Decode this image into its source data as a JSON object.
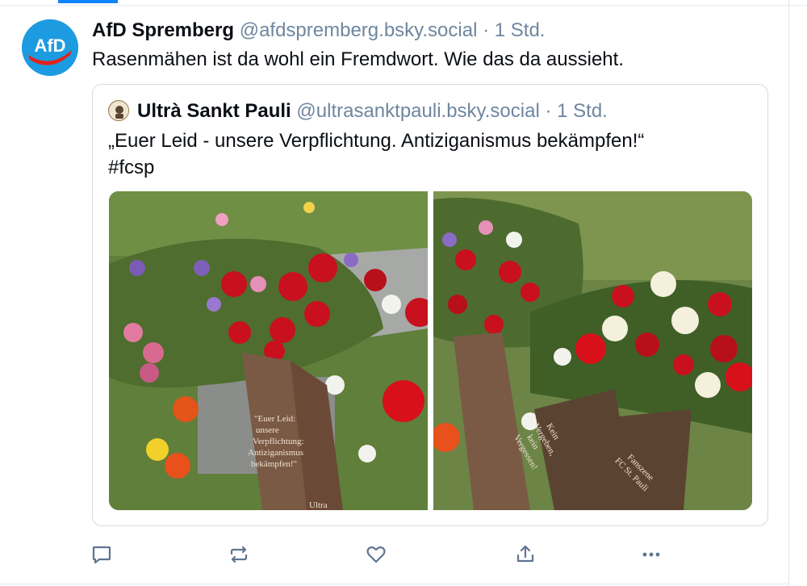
{
  "post": {
    "author_name": "AfD Spremberg",
    "author_handle": "@afdspremberg.bsky.social",
    "separator": "·",
    "time": "1 Std.",
    "avatar_text": "AfD",
    "text": "Rasenmähen ist da wohl ein Fremdwort. Wie das da aussieht."
  },
  "quote": {
    "author_name": "Ultrà Sankt Pauli",
    "author_handle": "@ultrasanktpauli.bsky.social",
    "separator": "·",
    "time": "1 Std.",
    "text_lines": [
      "„Euer Leid - unsere Verpflichtung. Antiziganismus bekämpfen!“",
      "#fcsp"
    ],
    "images": [
      {
        "ribbon_lines": [
          "\"Euer Leid:",
          "unsere",
          "Verpflichtung:",
          "Antiziganismus",
          "bekämpfen!\""
        ],
        "ribbon_footer": "Ultra"
      },
      {
        "ribbon_left_lines": [
          "Kein",
          "Vergeben,",
          "kein",
          "Vergessen!"
        ],
        "ribbon_right_lines": [
          "Fanszene",
          "FC St. Pauli"
        ]
      }
    ]
  },
  "actions": [
    {
      "name": "reply",
      "icon": "speech-bubble-icon"
    },
    {
      "name": "repost",
      "icon": "repost-icon"
    },
    {
      "name": "like",
      "icon": "heart-icon"
    },
    {
      "name": "share",
      "icon": "share-icon"
    },
    {
      "name": "more",
      "icon": "ellipsis-icon"
    }
  ],
  "colors": {
    "accent": "#1083fe",
    "muted": "#6f869f",
    "text": "#0b0f14",
    "border": "#d4dbe2"
  }
}
